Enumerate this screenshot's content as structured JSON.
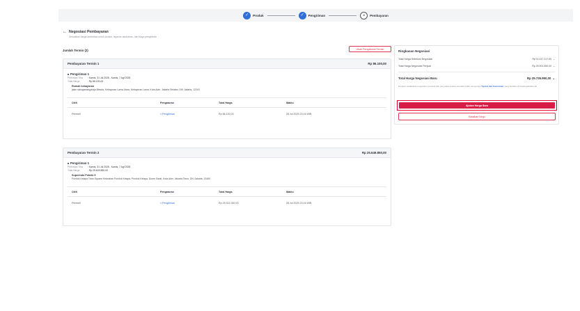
{
  "stepper": {
    "steps": [
      {
        "label": "Produk",
        "marker": "✓",
        "state": "done"
      },
      {
        "label": "Pengiriman",
        "marker": "✓",
        "state": "done"
      },
      {
        "label": "Pembayaran",
        "marker": "3",
        "state": "current"
      }
    ]
  },
  "header": {
    "title": "Negosiasi Pembayaran",
    "subtitle": "Sesuaikan harga tambahan untuk produk, layanan tambahan, dan biaya pengiriman",
    "back_icon": "arrow-left-icon"
  },
  "terms": {
    "count_label": "Jumlah Termin (2)",
    "change_button": "Ubah Pengaturan Termin",
    "items": [
      {
        "title": "Pembayaran Termin 1",
        "amount": "Rp 86.100,00",
        "shipment_title": "Pengiriman 1",
        "receive_label": "Perkiraan Tiba",
        "receive_value": ": Kamis, 31 Jul 2025 - Kamis, 7 Agt 2025",
        "total_label": "Total Harga",
        "total_value": ": Rp 86.100,00",
        "address_name": "Rumah kebayoran",
        "address_line": "jalan sisingamangaraja Blesda, Kebayoran Lama Utara, Kebayoran Lama, Kota Adm. Jakarta Selatan, DKI Jakarta, 12240",
        "table": {
          "headers": [
            "Oleh",
            "Pengaturan",
            "Total Harga",
            "Waktu"
          ],
          "row": {
            "by": "Pembeli",
            "setting": "1 Pengiriman",
            "total": "Rp 86.100,00",
            "time": "28 Jul 2025 23:16 WIB"
          }
        }
      },
      {
        "title": "Pembayaran Termin 2",
        "amount": "Rp 25.649.850,00",
        "shipment_title": "Pengiriman 1",
        "receive_label": "Perkiraan Tiba",
        "receive_value": ": Kamis, 31 Jul 2025 - Kamis, 7 Agt 2025",
        "total_label": "Total Harga",
        "total_value": ": Rp 25.649.850,00",
        "address_name": "Superindo Pokets 9",
        "address_line": "Pondok Kelapa Town Square Kelurahan Pondok Kelapa, Pondok Kelapa, Duren Sawit, Kota Adm. Jakarta Timur, DKI Jakarta, 13450",
        "table": {
          "headers": [
            "Oleh",
            "Pengaturan",
            "Total Harga",
            "Waktu"
          ],
          "row": {
            "by": "Pembeli",
            "setting": "1 Pengiriman",
            "total": "Rp 25.522.350,00",
            "time": "28 Jul 2025 23:16 WIB"
          }
        }
      }
    ]
  },
  "summary": {
    "title": "Ringkasan Negosiasi",
    "rows": [
      {
        "label": "Total Harga Sebelum Negosiasi",
        "value": "Rp 11.017.217,00"
      },
      {
        "label": "Total Harga Negosiasi Penjual",
        "value": "Rp 25.901.450,00"
      }
    ],
    "total_label": "Total Harga Negosiasi Baru",
    "total_value": "Rp 25.735.950,00",
    "note_pre": "Dengan melakukan negosiasi, pembeli dan penyedia secara otomatis telah menyetujui ",
    "note_link": "Syarat dan Ketentuan",
    "note_post": " yang berlaku di Katalog Elektronik",
    "submit_button": "Ajukan Harga Baru",
    "cancel_button": "Batalkan Nego",
    "chevron_icon": "chevron-down-icon"
  },
  "colors": {
    "accent_blue": "#2f6fd8",
    "primary_red": "#d81e47",
    "highlight_red": "#e0002b"
  }
}
